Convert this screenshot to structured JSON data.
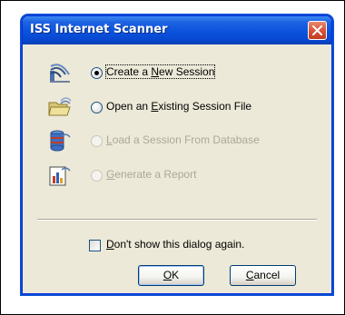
{
  "window": {
    "title": "ISS Internet Scanner"
  },
  "options": [
    {
      "label": "Create a New Session",
      "icon": "new-session-icon",
      "checked": true,
      "enabled": true
    },
    {
      "label": "Open an Existing Session File",
      "icon": "open-folder-icon",
      "checked": false,
      "enabled": true
    },
    {
      "label": "Load a Session From Database",
      "icon": "database-icon",
      "checked": false,
      "enabled": false
    },
    {
      "label": "Generate a Report",
      "icon": "report-icon",
      "checked": false,
      "enabled": false
    }
  ],
  "dont_show": {
    "label": "Don't show this dialog again.",
    "checked": false
  },
  "buttons": {
    "ok": "OK",
    "cancel": "Cancel"
  },
  "colors": {
    "titlebar": "#0a52dc",
    "dialog_bg": "#ece9d8",
    "disabled_text": "#aca899",
    "close_button": "#d8543a"
  }
}
